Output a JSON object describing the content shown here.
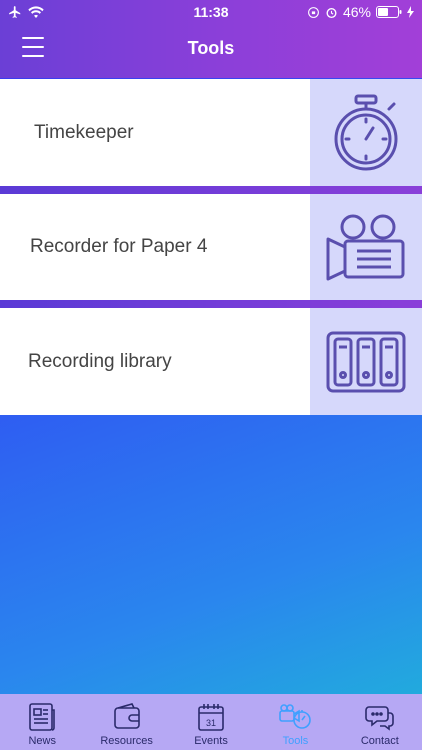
{
  "status": {
    "time": "11:38",
    "battery": "46%"
  },
  "header": {
    "title": "Tools"
  },
  "tools": [
    {
      "label": "Timekeeper",
      "icon": "stopwatch-icon"
    },
    {
      "label": "Recorder for Paper 4",
      "icon": "video-camera-icon"
    },
    {
      "label": "Recording library",
      "icon": "binders-icon"
    }
  ],
  "tabs": [
    {
      "label": "News",
      "icon": "newspaper-icon"
    },
    {
      "label": "Resources",
      "icon": "wallet-icon"
    },
    {
      "label": "Events",
      "icon": "calendar-icon",
      "day": "31"
    },
    {
      "label": "Tools",
      "icon": "tools-icon",
      "active": true
    },
    {
      "label": "Contact",
      "icon": "chat-bubbles-icon"
    }
  ],
  "colors": {
    "active_tab": "#3fa0ff",
    "icon_stroke": "#5a4fae",
    "icon_bg": "#d6d8fb"
  }
}
